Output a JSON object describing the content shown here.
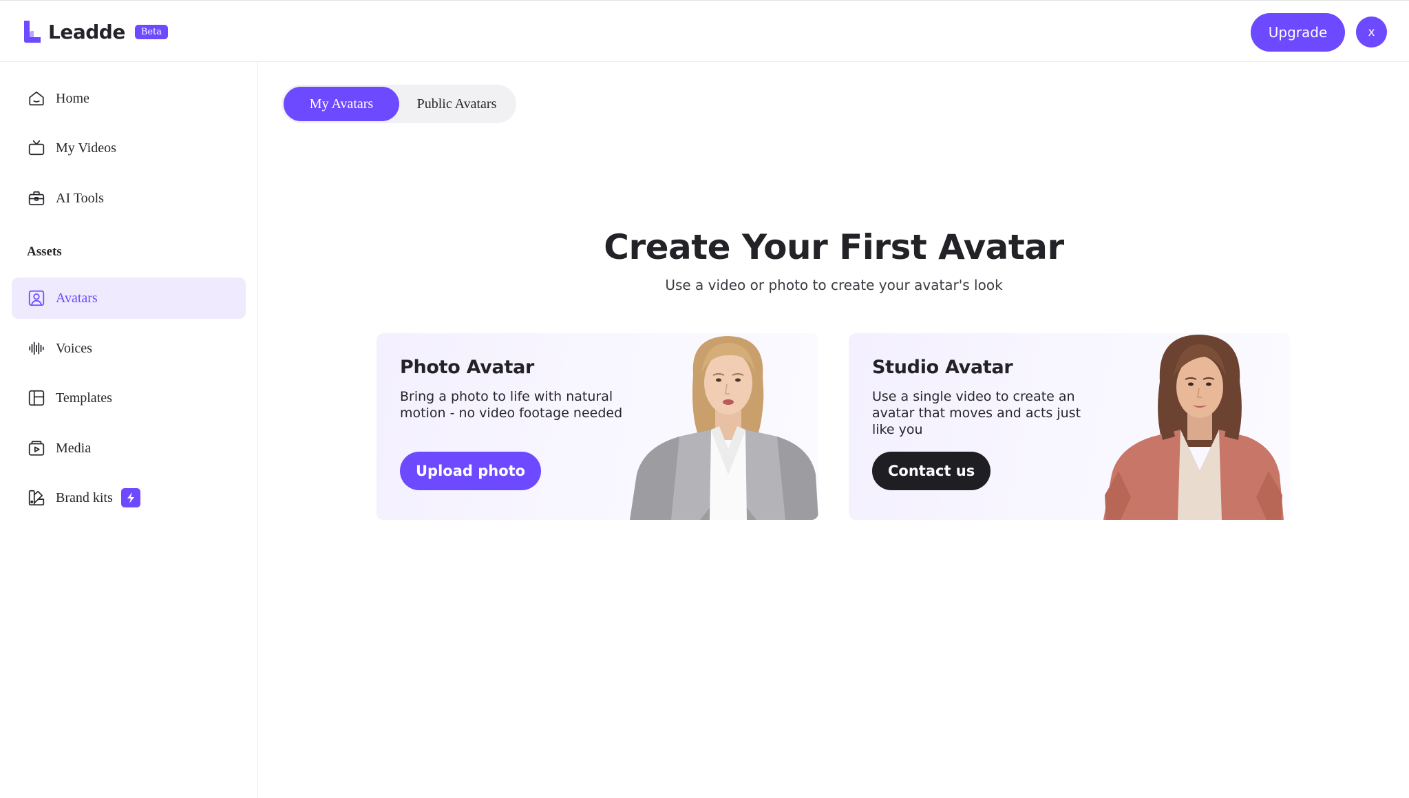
{
  "app": {
    "name": "Leadde",
    "badge": "Beta",
    "upgrade_label": "Upgrade",
    "user_initial": "x",
    "accent_color": "#6d4aff"
  },
  "sidebar": {
    "items": [
      {
        "label": "Home",
        "icon": "home-icon"
      },
      {
        "label": "My Videos",
        "icon": "tv-icon"
      },
      {
        "label": "AI Tools",
        "icon": "toolbox-icon"
      }
    ],
    "section_label": "Assets",
    "asset_items": [
      {
        "label": "Avatars",
        "icon": "user-square-icon",
        "active": true
      },
      {
        "label": "Voices",
        "icon": "waveform-icon"
      },
      {
        "label": "Templates",
        "icon": "layout-icon"
      },
      {
        "label": "Media",
        "icon": "media-icon"
      },
      {
        "label": "Brand kits",
        "icon": "palette-icon",
        "badge_icon": "bolt-icon"
      }
    ]
  },
  "tabs": [
    {
      "label": "My Avatars",
      "active": true
    },
    {
      "label": "Public Avatars",
      "active": false
    }
  ],
  "hero": {
    "title": "Create Your First Avatar",
    "subtitle": "Use a video or photo to create your avatar's look"
  },
  "cards": [
    {
      "title": "Photo Avatar",
      "description": "Bring a photo to life with natural motion - no video footage needed",
      "button_label": "Upload photo",
      "image": "woman-in-gray-blazer"
    },
    {
      "title": "Studio Avatar",
      "description": "Use a single video to create an avatar that moves and acts just like you",
      "button_label": "Contact us",
      "image": "woman-in-pink-blouse"
    }
  ]
}
